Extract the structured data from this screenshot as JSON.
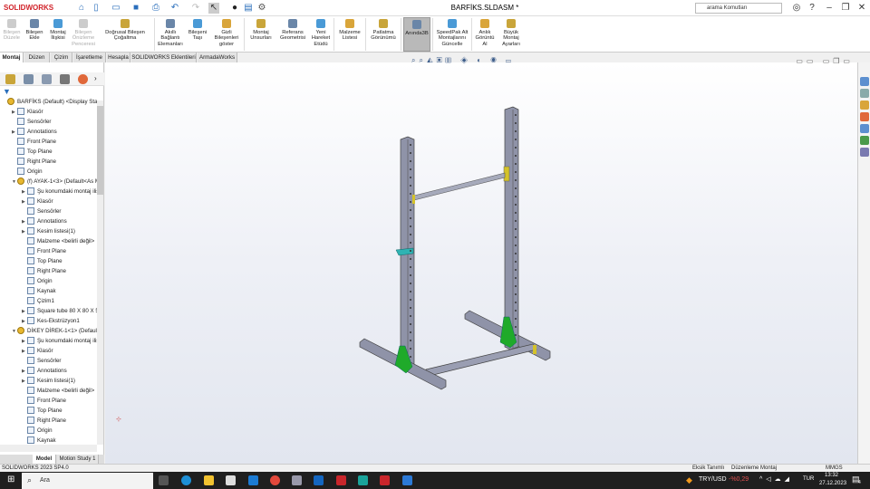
{
  "app": {
    "logo": "SOLIDWORKS",
    "title": "BARFİKS.SLDASM *",
    "search_placeholder": "arama Komutları"
  },
  "ribbon": [
    {
      "label": "Bileşen Düzele",
      "disabled": true,
      "icon": "edit-component-icon"
    },
    {
      "label": "Bileşen Ekle",
      "icon": "insert-component-icon"
    },
    {
      "label": "Montaj İlişkisi",
      "icon": "mate-icon"
    },
    {
      "label": "Bileşen Önizleme Penceresi",
      "disabled": true,
      "icon": "preview-window-icon"
    },
    {
      "label": "Doğrusal Bileşen Çoğaltma",
      "icon": "linear-pattern-icon"
    },
    {
      "label": "Akıllı Bağlantı Elemanları",
      "icon": "smart-fasteners-icon"
    },
    {
      "label": "Bileşeni Taşı",
      "icon": "move-component-icon"
    },
    {
      "label": "Gizli Bileşenleri göster",
      "icon": "show-hidden-icon"
    },
    {
      "label": "Montaj Unsurları",
      "icon": "assembly-features-icon"
    },
    {
      "label": "Referans Geometrisi",
      "icon": "reference-geometry-icon"
    },
    {
      "label": "Yeni Hareket Etüdü",
      "icon": "motion-study-icon"
    },
    {
      "label": "Malzeme Listesi",
      "icon": "bom-icon"
    },
    {
      "label": "Patlatma Görünümü",
      "icon": "exploded-view-icon"
    },
    {
      "label": "Anında3B",
      "active": true,
      "icon": "instant3d-icon"
    },
    {
      "label": "SpeedPak Alt Montajlarını Güncelle",
      "icon": "speedpak-icon"
    },
    {
      "label": "Anlık Görüntü Al",
      "icon": "snapshot-icon"
    },
    {
      "label": "Büyük Montaj Ayarları",
      "icon": "large-assembly-icon"
    }
  ],
  "tabs": [
    "Montaj",
    "Düzen",
    "Çizim",
    "İşaretleme",
    "Hesapla",
    "SOLIDWORKS Eklentileri",
    "ArmadaWorks"
  ],
  "tree": [
    {
      "label": "BARFİKS (Default) <Display State-1>",
      "level": 0,
      "arrow": ""
    },
    {
      "label": "Klasör",
      "level": 1,
      "arrow": "▶"
    },
    {
      "label": "Sensörler",
      "level": 1,
      "arrow": ""
    },
    {
      "label": "Annotations",
      "level": 1,
      "arrow": "▶"
    },
    {
      "label": "Front Plane",
      "level": 1,
      "arrow": ""
    },
    {
      "label": "Top Plane",
      "level": 1,
      "arrow": ""
    },
    {
      "label": "Right Plane",
      "level": 1,
      "arrow": ""
    },
    {
      "label": "Origin",
      "level": 1,
      "arrow": ""
    },
    {
      "label": "(f) AYAK-1<3> (Default<As Machined>)",
      "level": 1,
      "arrow": "▼"
    },
    {
      "label": "Şu konumdaki montaj ilişkileri",
      "level": 2,
      "arrow": "▶"
    },
    {
      "label": "Klasör",
      "level": 2,
      "arrow": "▶"
    },
    {
      "label": "Sensörler",
      "level": 2,
      "arrow": ""
    },
    {
      "label": "Annotations",
      "level": 2,
      "arrow": "▶"
    },
    {
      "label": "Kesim listesi(1)",
      "level": 2,
      "arrow": "▶"
    },
    {
      "label": "Malzeme <belirli değil>",
      "level": 2,
      "arrow": ""
    },
    {
      "label": "Front Plane",
      "level": 2,
      "arrow": ""
    },
    {
      "label": "Top Plane",
      "level": 2,
      "arrow": ""
    },
    {
      "label": "Right Plane",
      "level": 2,
      "arrow": ""
    },
    {
      "label": "Origin",
      "level": 2,
      "arrow": ""
    },
    {
      "label": "Kaynak",
      "level": 2,
      "arrow": ""
    },
    {
      "label": "Çizim1",
      "level": 2,
      "arrow": ""
    },
    {
      "label": "Square tube 80 X 80 X 5(1)",
      "level": 2,
      "arrow": "▶"
    },
    {
      "label": "Kes-Ekstrüzyon1",
      "level": 2,
      "arrow": "▶"
    },
    {
      "label": "DİKEY DİREK-1<1> (Default<As Machined>)",
      "level": 1,
      "arrow": "▼"
    },
    {
      "label": "Şu konumdaki montaj ilişkileri",
      "level": 2,
      "arrow": "▶"
    },
    {
      "label": "Klasör",
      "level": 2,
      "arrow": "▶"
    },
    {
      "label": "Sensörler",
      "level": 2,
      "arrow": ""
    },
    {
      "label": "Annotations",
      "level": 2,
      "arrow": "▶"
    },
    {
      "label": "Kesim listesi(1)",
      "level": 2,
      "arrow": "▶"
    },
    {
      "label": "Malzeme <belirli değil>",
      "level": 2,
      "arrow": ""
    },
    {
      "label": "Front Plane",
      "level": 2,
      "arrow": ""
    },
    {
      "label": "Top Plane",
      "level": 2,
      "arrow": ""
    },
    {
      "label": "Right Plane",
      "level": 2,
      "arrow": ""
    },
    {
      "label": "Origin",
      "level": 2,
      "arrow": ""
    },
    {
      "label": "Kaynak",
      "level": 2,
      "arrow": ""
    }
  ],
  "bottom_tabs": [
    "Model",
    "Motion Study 1"
  ],
  "status": {
    "version": "SOLIDWORKS 2023 SP4.0",
    "definition": "Eksik Tanımlı",
    "mode": "Düzenleme Montaj",
    "units": "MMGS"
  },
  "taskbar": {
    "search": "Ara",
    "ticker": "TRY/USD",
    "change": "-%0,29",
    "lang": "TUR",
    "time": "13:32",
    "date": "27.12.2023",
    "notifications": "4"
  },
  "colors": {
    "accent": "#d1232a",
    "frame": "#8f93a8",
    "gusset": "#1faa2a",
    "bracket": "#d4c22a",
    "jhook": "#2fb3b3"
  }
}
